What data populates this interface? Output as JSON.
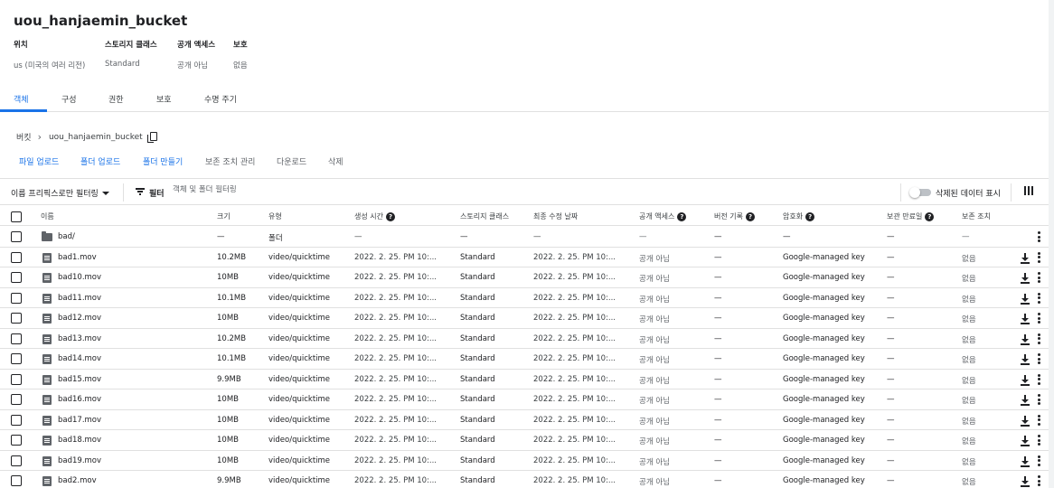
{
  "bucket": {
    "name": "uou_hanjaemin_bucket",
    "meta": [
      {
        "label": "위치",
        "value": "us (미국의 여러 리전)"
      },
      {
        "label": "스토리지 클래스",
        "value": "Standard"
      },
      {
        "label": "공개 액세스",
        "value": "공개 아님"
      },
      {
        "label": "보호",
        "value": "없음"
      }
    ]
  },
  "tabs": [
    {
      "label": "객체",
      "active": true
    },
    {
      "label": "구성"
    },
    {
      "label": "권한"
    },
    {
      "label": "보호"
    },
    {
      "label": "수명 주기"
    }
  ],
  "breadcrumb": {
    "root": "버킷",
    "current": "uou_hanjaemin_bucket"
  },
  "actions": {
    "upload_files": "파일 업로드",
    "upload_folder": "폴더 업로드",
    "create_folder": "폴더 만들기",
    "manage_holds": "보존 조치 관리",
    "download": "다운로드",
    "delete": "삭제"
  },
  "filterbar": {
    "prefix_filter": "이름 프리픽스로만 필터링",
    "filter_label": "필터",
    "placeholder": "객체 및 폴더 필터링",
    "show_deleted": "삭제된 데이터 표시"
  },
  "columns": {
    "name": "이름",
    "size": "크기",
    "type": "유형",
    "created": "생성 시간",
    "storage_class": "스토리지 클래스",
    "modified": "최종 수정 날짜",
    "public_access": "공개 액세스",
    "version_history": "버전 기록",
    "encryption": "암호화",
    "retention_until": "보관 만료일",
    "holds": "보존 조치"
  },
  "rows": [
    {
      "name": "bad/",
      "kind": "folder",
      "size": "—",
      "type": "폴더",
      "created": "—",
      "storage_class": "—",
      "modified": "—",
      "public_access": "—",
      "version_history": "—",
      "encryption": "—",
      "retention_until": "—",
      "holds": "—"
    },
    {
      "name": "bad1.mov",
      "kind": "file",
      "size": "10.2MB",
      "type": "video/quicktime",
      "created": "2022. 2. 25. PM 10:...",
      "storage_class": "Standard",
      "modified": "2022. 2. 25. PM 10:...",
      "public_access": "공개 아님",
      "version_history": "—",
      "encryption": "Google-managed key",
      "retention_until": "—",
      "holds": "없음"
    },
    {
      "name": "bad10.mov",
      "kind": "file",
      "size": "10MB",
      "type": "video/quicktime",
      "created": "2022. 2. 25. PM 10:...",
      "storage_class": "Standard",
      "modified": "2022. 2. 25. PM 10:...",
      "public_access": "공개 아님",
      "version_history": "—",
      "encryption": "Google-managed key",
      "retention_until": "—",
      "holds": "없음"
    },
    {
      "name": "bad11.mov",
      "kind": "file",
      "size": "10.1MB",
      "type": "video/quicktime",
      "created": "2022. 2. 25. PM 10:...",
      "storage_class": "Standard",
      "modified": "2022. 2. 25. PM 10:...",
      "public_access": "공개 아님",
      "version_history": "—",
      "encryption": "Google-managed key",
      "retention_until": "—",
      "holds": "없음"
    },
    {
      "name": "bad12.mov",
      "kind": "file",
      "size": "10MB",
      "type": "video/quicktime",
      "created": "2022. 2. 25. PM 10:...",
      "storage_class": "Standard",
      "modified": "2022. 2. 25. PM 10:...",
      "public_access": "공개 아님",
      "version_history": "—",
      "encryption": "Google-managed key",
      "retention_until": "—",
      "holds": "없음"
    },
    {
      "name": "bad13.mov",
      "kind": "file",
      "size": "10.2MB",
      "type": "video/quicktime",
      "created": "2022. 2. 25. PM 10:...",
      "storage_class": "Standard",
      "modified": "2022. 2. 25. PM 10:...",
      "public_access": "공개 아님",
      "version_history": "—",
      "encryption": "Google-managed key",
      "retention_until": "—",
      "holds": "없음"
    },
    {
      "name": "bad14.mov",
      "kind": "file",
      "size": "10.1MB",
      "type": "video/quicktime",
      "created": "2022. 2. 25. PM 10:...",
      "storage_class": "Standard",
      "modified": "2022. 2. 25. PM 10:...",
      "public_access": "공개 아님",
      "version_history": "—",
      "encryption": "Google-managed key",
      "retention_until": "—",
      "holds": "없음"
    },
    {
      "name": "bad15.mov",
      "kind": "file",
      "size": "9.9MB",
      "type": "video/quicktime",
      "created": "2022. 2. 25. PM 10:...",
      "storage_class": "Standard",
      "modified": "2022. 2. 25. PM 10:...",
      "public_access": "공개 아님",
      "version_history": "—",
      "encryption": "Google-managed key",
      "retention_until": "—",
      "holds": "없음"
    },
    {
      "name": "bad16.mov",
      "kind": "file",
      "size": "10MB",
      "type": "video/quicktime",
      "created": "2022. 2. 25. PM 10:...",
      "storage_class": "Standard",
      "modified": "2022. 2. 25. PM 10:...",
      "public_access": "공개 아님",
      "version_history": "—",
      "encryption": "Google-managed key",
      "retention_until": "—",
      "holds": "없음"
    },
    {
      "name": "bad17.mov",
      "kind": "file",
      "size": "10MB",
      "type": "video/quicktime",
      "created": "2022. 2. 25. PM 10:...",
      "storage_class": "Standard",
      "modified": "2022. 2. 25. PM 10:...",
      "public_access": "공개 아님",
      "version_history": "—",
      "encryption": "Google-managed key",
      "retention_until": "—",
      "holds": "없음"
    },
    {
      "name": "bad18.mov",
      "kind": "file",
      "size": "10MB",
      "type": "video/quicktime",
      "created": "2022. 2. 25. PM 10:...",
      "storage_class": "Standard",
      "modified": "2022. 2. 25. PM 10:...",
      "public_access": "공개 아님",
      "version_history": "—",
      "encryption": "Google-managed key",
      "retention_until": "—",
      "holds": "없음"
    },
    {
      "name": "bad19.mov",
      "kind": "file",
      "size": "10MB",
      "type": "video/quicktime",
      "created": "2022. 2. 25. PM 10:...",
      "storage_class": "Standard",
      "modified": "2022. 2. 25. PM 10:...",
      "public_access": "공개 아님",
      "version_history": "—",
      "encryption": "Google-managed key",
      "retention_until": "—",
      "holds": "없음"
    },
    {
      "name": "bad2.mov",
      "kind": "file",
      "size": "9.9MB",
      "type": "video/quicktime",
      "created": "2022. 2. 25. PM 10:...",
      "storage_class": "Standard",
      "modified": "2022. 2. 25. PM 10:...",
      "public_access": "공개 아님",
      "version_history": "—",
      "encryption": "Google-managed key",
      "retention_until": "—",
      "holds": "없음"
    }
  ]
}
